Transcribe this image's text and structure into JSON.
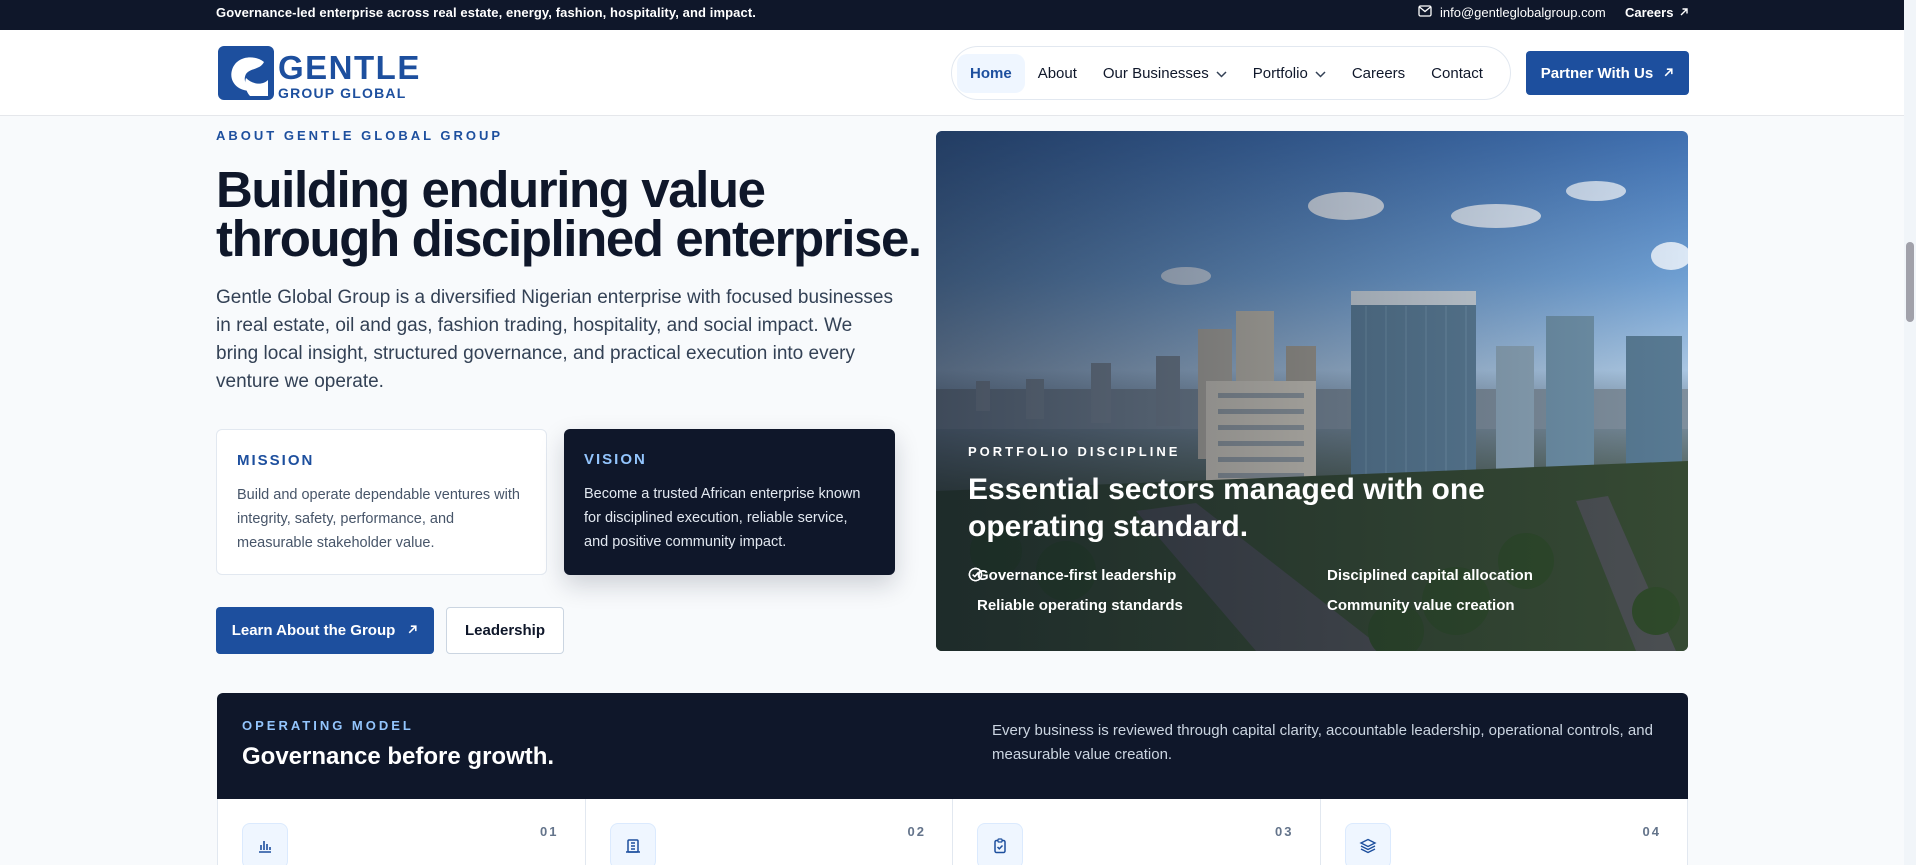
{
  "topbar": {
    "tagline": "Governance-led enterprise across real estate, energy, fashion, hospitality, and impact.",
    "email": "info@gentleglobalgroup.com",
    "careers": "Careers"
  },
  "logo": {
    "line1": "GENTLE",
    "line2": "GROUP GLOBAL"
  },
  "nav": {
    "items": [
      "Home",
      "About",
      "Our Businesses",
      "Portfolio",
      "Careers",
      "Contact"
    ],
    "active": "Home",
    "cta": "Partner With Us"
  },
  "hero": {
    "eyebrow": "ABOUT GENTLE GLOBAL GROUP",
    "title_line1": "Building enduring value",
    "title_line2": "through disciplined enterprise.",
    "description": "Gentle Global Group is a diversified Nigerian enterprise with focused businesses in real estate, oil and gas, fashion trading, hospitality, and social impact. We bring local insight, structured governance, and practical execution into every venture we operate.",
    "mission": {
      "title": "MISSION",
      "text": "Build and operate dependable ventures with integrity, safety, performance, and measurable stakeholder value."
    },
    "vision": {
      "title": "VISION",
      "text": "Become a trusted African enterprise known for disciplined execution, reliable service, and positive community impact."
    },
    "primary_button": "Learn About the Group",
    "secondary_button": "Leadership"
  },
  "hero_image": {
    "eyebrow": "PORTFOLIO DISCIPLINE",
    "title": "Essential sectors managed with one operating standard.",
    "points": [
      "Governance-first leadership",
      "Disciplined capital allocation",
      "Reliable operating standards",
      "Community value creation"
    ]
  },
  "operating_model": {
    "eyebrow": "OPERATING MODEL",
    "title": "Governance before growth.",
    "description": "Every business is reviewed through capital clarity, accountable leadership, operational controls, and measurable value creation.",
    "steps": [
      {
        "number": "01",
        "icon": "bar-chart-icon"
      },
      {
        "number": "02",
        "icon": "building-icon"
      },
      {
        "number": "03",
        "icon": "clipboard-check-icon"
      },
      {
        "number": "04",
        "icon": "layers-icon"
      }
    ]
  },
  "colors": {
    "brand": "#1d4f9e",
    "navy": "#0f172a",
    "accent_light": "#93c5fd"
  }
}
